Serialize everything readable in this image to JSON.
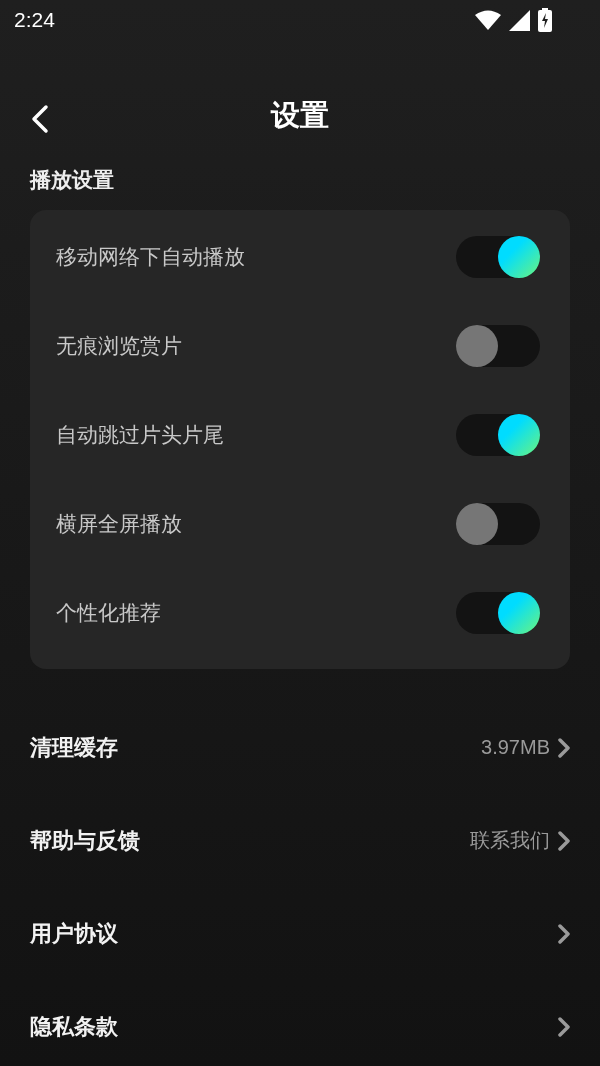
{
  "status_bar": {
    "time": "2:24"
  },
  "header": {
    "title": "设置"
  },
  "section": {
    "title": "播放设置"
  },
  "toggles": [
    {
      "label": "移动网络下自动播放",
      "on": true
    },
    {
      "label": "无痕浏览赏片",
      "on": false
    },
    {
      "label": "自动跳过片头片尾",
      "on": true
    },
    {
      "label": "横屏全屏播放",
      "on": false
    },
    {
      "label": "个性化推荐",
      "on": true
    }
  ],
  "links": [
    {
      "label": "清理缓存",
      "value": "3.97MB"
    },
    {
      "label": "帮助与反馈",
      "value": "联系我们"
    },
    {
      "label": "用户协议"
    },
    {
      "label": "隐私条款"
    }
  ]
}
